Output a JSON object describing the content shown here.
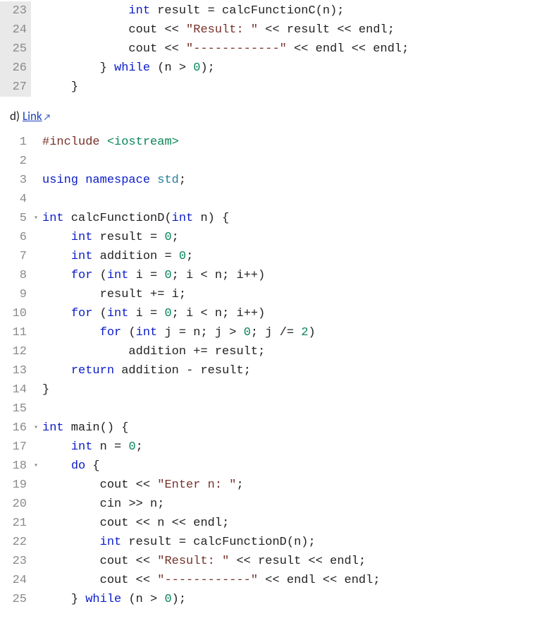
{
  "section_d": {
    "prefix": "d) ",
    "link_text": "Link"
  },
  "block1": {
    "lines": [
      {
        "n": "23",
        "hl": true,
        "fold": "",
        "tokens": [
          {
            "t": "            ",
            "c": ""
          },
          {
            "t": "int",
            "c": "ty"
          },
          {
            "t": " result ",
            "c": "id"
          },
          {
            "t": "=",
            "c": "op"
          },
          {
            "t": " calcFunctionC",
            "c": "fn"
          },
          {
            "t": "(",
            "c": "p"
          },
          {
            "t": "n",
            "c": "id"
          },
          {
            "t": ");",
            "c": "p"
          }
        ]
      },
      {
        "n": "24",
        "hl": true,
        "fold": "",
        "tokens": [
          {
            "t": "            ",
            "c": ""
          },
          {
            "t": "cout ",
            "c": "id"
          },
          {
            "t": "<<",
            "c": "op"
          },
          {
            "t": " ",
            "c": ""
          },
          {
            "t": "\"Result: \"",
            "c": "str"
          },
          {
            "t": " ",
            "c": ""
          },
          {
            "t": "<<",
            "c": "op"
          },
          {
            "t": " result ",
            "c": "id"
          },
          {
            "t": "<<",
            "c": "op"
          },
          {
            "t": " endl",
            "c": "id"
          },
          {
            "t": ";",
            "c": "p"
          }
        ]
      },
      {
        "n": "25",
        "hl": true,
        "fold": "",
        "tokens": [
          {
            "t": "            ",
            "c": ""
          },
          {
            "t": "cout ",
            "c": "id"
          },
          {
            "t": "<<",
            "c": "op"
          },
          {
            "t": " ",
            "c": ""
          },
          {
            "t": "\"------------\"",
            "c": "str"
          },
          {
            "t": " ",
            "c": ""
          },
          {
            "t": "<<",
            "c": "op"
          },
          {
            "t": " endl ",
            "c": "id"
          },
          {
            "t": "<<",
            "c": "op"
          },
          {
            "t": " endl",
            "c": "id"
          },
          {
            "t": ";",
            "c": "p"
          }
        ]
      },
      {
        "n": "26",
        "hl": true,
        "fold": "",
        "tokens": [
          {
            "t": "        ",
            "c": ""
          },
          {
            "t": "}",
            "c": "p"
          },
          {
            "t": " ",
            "c": ""
          },
          {
            "t": "while",
            "c": "k"
          },
          {
            "t": " ",
            "c": ""
          },
          {
            "t": "(",
            "c": "p"
          },
          {
            "t": "n ",
            "c": "id"
          },
          {
            "t": ">",
            "c": "op"
          },
          {
            "t": " ",
            "c": ""
          },
          {
            "t": "0",
            "c": "num"
          },
          {
            "t": ");",
            "c": "p"
          }
        ]
      },
      {
        "n": "27",
        "hl": true,
        "fold": "",
        "tokens": [
          {
            "t": "    ",
            "c": ""
          },
          {
            "t": "}",
            "c": "p"
          }
        ]
      }
    ]
  },
  "block2": {
    "lines": [
      {
        "n": "1",
        "fold": "",
        "tokens": [
          {
            "t": "#include",
            "c": "pre"
          },
          {
            "t": " ",
            "c": ""
          },
          {
            "t": "<iostream>",
            "c": "inc"
          }
        ]
      },
      {
        "n": "2",
        "fold": "",
        "tokens": []
      },
      {
        "n": "3",
        "fold": "",
        "tokens": [
          {
            "t": "using",
            "c": "k"
          },
          {
            "t": " ",
            "c": ""
          },
          {
            "t": "namespace",
            "c": "k"
          },
          {
            "t": " ",
            "c": ""
          },
          {
            "t": "std",
            "c": "ns"
          },
          {
            "t": ";",
            "c": "p"
          }
        ]
      },
      {
        "n": "4",
        "fold": "",
        "tokens": []
      },
      {
        "n": "5",
        "fold": "▾",
        "tokens": [
          {
            "t": "int",
            "c": "ty"
          },
          {
            "t": " calcFunctionD",
            "c": "fn"
          },
          {
            "t": "(",
            "c": "p"
          },
          {
            "t": "int",
            "c": "ty"
          },
          {
            "t": " n",
            "c": "id"
          },
          {
            "t": ")",
            "c": "p"
          },
          {
            "t": " ",
            "c": ""
          },
          {
            "t": "{",
            "c": "p"
          }
        ]
      },
      {
        "n": "6",
        "fold": "",
        "tokens": [
          {
            "t": "    ",
            "c": ""
          },
          {
            "t": "int",
            "c": "ty"
          },
          {
            "t": " result ",
            "c": "id"
          },
          {
            "t": "=",
            "c": "op"
          },
          {
            "t": " ",
            "c": ""
          },
          {
            "t": "0",
            "c": "num"
          },
          {
            "t": ";",
            "c": "p"
          }
        ]
      },
      {
        "n": "7",
        "fold": "",
        "tokens": [
          {
            "t": "    ",
            "c": ""
          },
          {
            "t": "int",
            "c": "ty"
          },
          {
            "t": " addition ",
            "c": "id"
          },
          {
            "t": "=",
            "c": "op"
          },
          {
            "t": " ",
            "c": ""
          },
          {
            "t": "0",
            "c": "num"
          },
          {
            "t": ";",
            "c": "p"
          }
        ]
      },
      {
        "n": "8",
        "fold": "",
        "tokens": [
          {
            "t": "    ",
            "c": ""
          },
          {
            "t": "for",
            "c": "k"
          },
          {
            "t": " ",
            "c": ""
          },
          {
            "t": "(",
            "c": "p"
          },
          {
            "t": "int",
            "c": "ty"
          },
          {
            "t": " i ",
            "c": "id"
          },
          {
            "t": "=",
            "c": "op"
          },
          {
            "t": " ",
            "c": ""
          },
          {
            "t": "0",
            "c": "num"
          },
          {
            "t": ";",
            "c": "p"
          },
          {
            "t": " i ",
            "c": "id"
          },
          {
            "t": "<",
            "c": "op"
          },
          {
            "t": " n",
            "c": "id"
          },
          {
            "t": ";",
            "c": "p"
          },
          {
            "t": " i",
            "c": "id"
          },
          {
            "t": "++",
            "c": "op"
          },
          {
            "t": ")",
            "c": "p"
          }
        ]
      },
      {
        "n": "9",
        "fold": "",
        "tokens": [
          {
            "t": "        ",
            "c": ""
          },
          {
            "t": "result ",
            "c": "id"
          },
          {
            "t": "+=",
            "c": "op"
          },
          {
            "t": " i",
            "c": "id"
          },
          {
            "t": ";",
            "c": "p"
          }
        ]
      },
      {
        "n": "10",
        "fold": "",
        "tokens": [
          {
            "t": "    ",
            "c": ""
          },
          {
            "t": "for",
            "c": "k"
          },
          {
            "t": " ",
            "c": ""
          },
          {
            "t": "(",
            "c": "p"
          },
          {
            "t": "int",
            "c": "ty"
          },
          {
            "t": " i ",
            "c": "id"
          },
          {
            "t": "=",
            "c": "op"
          },
          {
            "t": " ",
            "c": ""
          },
          {
            "t": "0",
            "c": "num"
          },
          {
            "t": ";",
            "c": "p"
          },
          {
            "t": " i ",
            "c": "id"
          },
          {
            "t": "<",
            "c": "op"
          },
          {
            "t": " n",
            "c": "id"
          },
          {
            "t": ";",
            "c": "p"
          },
          {
            "t": " i",
            "c": "id"
          },
          {
            "t": "++",
            "c": "op"
          },
          {
            "t": ")",
            "c": "p"
          }
        ]
      },
      {
        "n": "11",
        "fold": "",
        "tokens": [
          {
            "t": "        ",
            "c": ""
          },
          {
            "t": "for",
            "c": "k"
          },
          {
            "t": " ",
            "c": ""
          },
          {
            "t": "(",
            "c": "p"
          },
          {
            "t": "int",
            "c": "ty"
          },
          {
            "t": " j ",
            "c": "id"
          },
          {
            "t": "=",
            "c": "op"
          },
          {
            "t": " n",
            "c": "id"
          },
          {
            "t": ";",
            "c": "p"
          },
          {
            "t": " j ",
            "c": "id"
          },
          {
            "t": ">",
            "c": "op"
          },
          {
            "t": " ",
            "c": ""
          },
          {
            "t": "0",
            "c": "num"
          },
          {
            "t": ";",
            "c": "p"
          },
          {
            "t": " j ",
            "c": "id"
          },
          {
            "t": "/=",
            "c": "op"
          },
          {
            "t": " ",
            "c": ""
          },
          {
            "t": "2",
            "c": "num"
          },
          {
            "t": ")",
            "c": "p"
          }
        ]
      },
      {
        "n": "12",
        "fold": "",
        "tokens": [
          {
            "t": "            ",
            "c": ""
          },
          {
            "t": "addition ",
            "c": "id"
          },
          {
            "t": "+=",
            "c": "op"
          },
          {
            "t": " result",
            "c": "id"
          },
          {
            "t": ";",
            "c": "p"
          }
        ]
      },
      {
        "n": "13",
        "fold": "",
        "tokens": [
          {
            "t": "    ",
            "c": ""
          },
          {
            "t": "return",
            "c": "k"
          },
          {
            "t": " addition ",
            "c": "id"
          },
          {
            "t": "-",
            "c": "op"
          },
          {
            "t": " result",
            "c": "id"
          },
          {
            "t": ";",
            "c": "p"
          }
        ]
      },
      {
        "n": "14",
        "fold": "",
        "tokens": [
          {
            "t": "}",
            "c": "p"
          }
        ]
      },
      {
        "n": "15",
        "fold": "",
        "tokens": []
      },
      {
        "n": "16",
        "fold": "▾",
        "tokens": [
          {
            "t": "int",
            "c": "ty"
          },
          {
            "t": " main",
            "c": "fn"
          },
          {
            "t": "()",
            "c": "p"
          },
          {
            "t": " ",
            "c": ""
          },
          {
            "t": "{",
            "c": "p"
          }
        ]
      },
      {
        "n": "17",
        "fold": "",
        "tokens": [
          {
            "t": "    ",
            "c": ""
          },
          {
            "t": "int",
            "c": "ty"
          },
          {
            "t": " n ",
            "c": "id"
          },
          {
            "t": "=",
            "c": "op"
          },
          {
            "t": " ",
            "c": ""
          },
          {
            "t": "0",
            "c": "num"
          },
          {
            "t": ";",
            "c": "p"
          }
        ]
      },
      {
        "n": "18",
        "fold": "▾",
        "tokens": [
          {
            "t": "    ",
            "c": ""
          },
          {
            "t": "do",
            "c": "k"
          },
          {
            "t": " ",
            "c": ""
          },
          {
            "t": "{",
            "c": "p"
          }
        ]
      },
      {
        "n": "19",
        "fold": "",
        "tokens": [
          {
            "t": "        ",
            "c": ""
          },
          {
            "t": "cout ",
            "c": "id"
          },
          {
            "t": "<<",
            "c": "op"
          },
          {
            "t": " ",
            "c": ""
          },
          {
            "t": "\"Enter n: \"",
            "c": "str"
          },
          {
            "t": ";",
            "c": "p"
          }
        ]
      },
      {
        "n": "20",
        "fold": "",
        "tokens": [
          {
            "t": "        ",
            "c": ""
          },
          {
            "t": "cin ",
            "c": "id"
          },
          {
            "t": ">>",
            "c": "op"
          },
          {
            "t": " n",
            "c": "id"
          },
          {
            "t": ";",
            "c": "p"
          }
        ]
      },
      {
        "n": "21",
        "fold": "",
        "tokens": [
          {
            "t": "        ",
            "c": ""
          },
          {
            "t": "cout ",
            "c": "id"
          },
          {
            "t": "<<",
            "c": "op"
          },
          {
            "t": " n ",
            "c": "id"
          },
          {
            "t": "<<",
            "c": "op"
          },
          {
            "t": " endl",
            "c": "id"
          },
          {
            "t": ";",
            "c": "p"
          }
        ]
      },
      {
        "n": "22",
        "fold": "",
        "tokens": [
          {
            "t": "        ",
            "c": ""
          },
          {
            "t": "int",
            "c": "ty"
          },
          {
            "t": " result ",
            "c": "id"
          },
          {
            "t": "=",
            "c": "op"
          },
          {
            "t": " calcFunctionD",
            "c": "fn"
          },
          {
            "t": "(",
            "c": "p"
          },
          {
            "t": "n",
            "c": "id"
          },
          {
            "t": ");",
            "c": "p"
          }
        ]
      },
      {
        "n": "23",
        "fold": "",
        "tokens": [
          {
            "t": "        ",
            "c": ""
          },
          {
            "t": "cout ",
            "c": "id"
          },
          {
            "t": "<<",
            "c": "op"
          },
          {
            "t": " ",
            "c": ""
          },
          {
            "t": "\"Result: \"",
            "c": "str"
          },
          {
            "t": " ",
            "c": ""
          },
          {
            "t": "<<",
            "c": "op"
          },
          {
            "t": " result ",
            "c": "id"
          },
          {
            "t": "<<",
            "c": "op"
          },
          {
            "t": " endl",
            "c": "id"
          },
          {
            "t": ";",
            "c": "p"
          }
        ]
      },
      {
        "n": "24",
        "fold": "",
        "tokens": [
          {
            "t": "        ",
            "c": ""
          },
          {
            "t": "cout ",
            "c": "id"
          },
          {
            "t": "<<",
            "c": "op"
          },
          {
            "t": " ",
            "c": ""
          },
          {
            "t": "\"------------\"",
            "c": "str"
          },
          {
            "t": " ",
            "c": ""
          },
          {
            "t": "<<",
            "c": "op"
          },
          {
            "t": " endl ",
            "c": "id"
          },
          {
            "t": "<<",
            "c": "op"
          },
          {
            "t": " endl",
            "c": "id"
          },
          {
            "t": ";",
            "c": "p"
          }
        ]
      },
      {
        "n": "25",
        "fold": "",
        "tokens": [
          {
            "t": "    ",
            "c": ""
          },
          {
            "t": "}",
            "c": "p"
          },
          {
            "t": " ",
            "c": ""
          },
          {
            "t": "while",
            "c": "k"
          },
          {
            "t": " ",
            "c": ""
          },
          {
            "t": "(",
            "c": "p"
          },
          {
            "t": "n ",
            "c": "id"
          },
          {
            "t": ">",
            "c": "op"
          },
          {
            "t": " ",
            "c": ""
          },
          {
            "t": "0",
            "c": "num"
          },
          {
            "t": ");",
            "c": "p"
          }
        ]
      }
    ]
  }
}
